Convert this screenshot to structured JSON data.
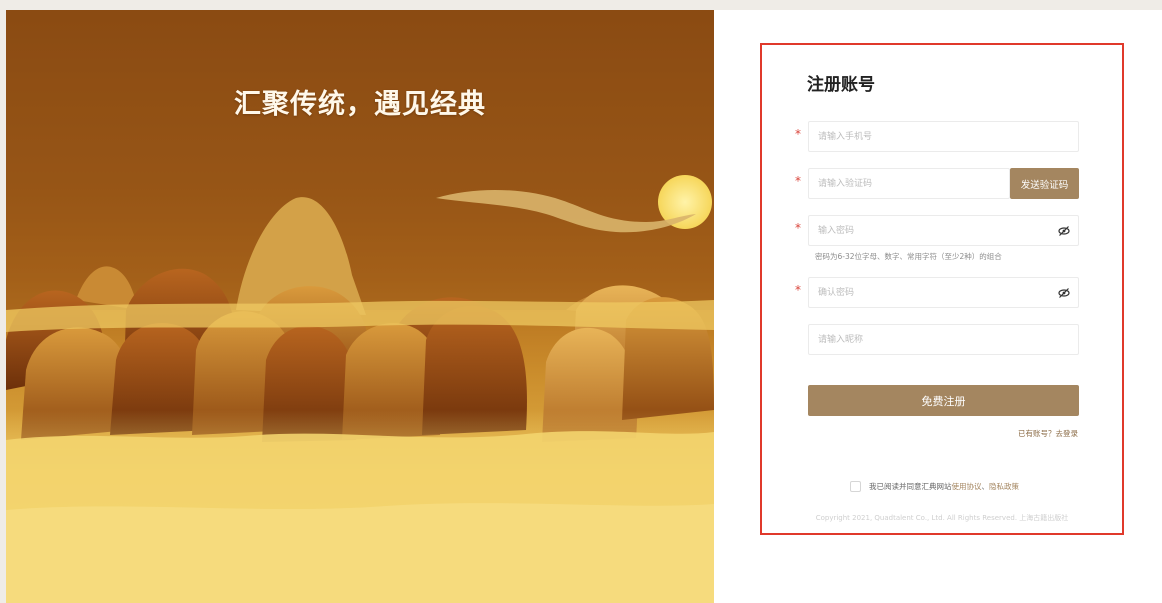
{
  "hero": {
    "slogan": "汇聚传统，遇见经典"
  },
  "register": {
    "title": "注册账号",
    "phone_placeholder": "请输入手机号",
    "code_placeholder": "请输入验证码",
    "send_code_label": "发送验证码",
    "password_placeholder": "输入密码",
    "password_hint": "密码为6-32位字母、数字、常用字符（至少2种）的组合",
    "confirm_placeholder": "确认密码",
    "nickname_placeholder": "请输入昵称",
    "required_mark": "*",
    "submit_label": "免费注册",
    "login_link": "已有账号？去登录",
    "agree_prefix": "我已阅读并同意汇典网站",
    "terms_link": "使用协议",
    "separator": "、",
    "privacy_link": "隐私政策",
    "copyright": "Copyright 2021, Quadtalent Co., Ltd. All Rights Reserved. 上海古籍出版社"
  },
  "icons": {
    "password_toggle": "eye-off-icon"
  },
  "colors": {
    "accent": "#a48660",
    "required": "#d9443a",
    "highlight_border": "#e0392b"
  }
}
